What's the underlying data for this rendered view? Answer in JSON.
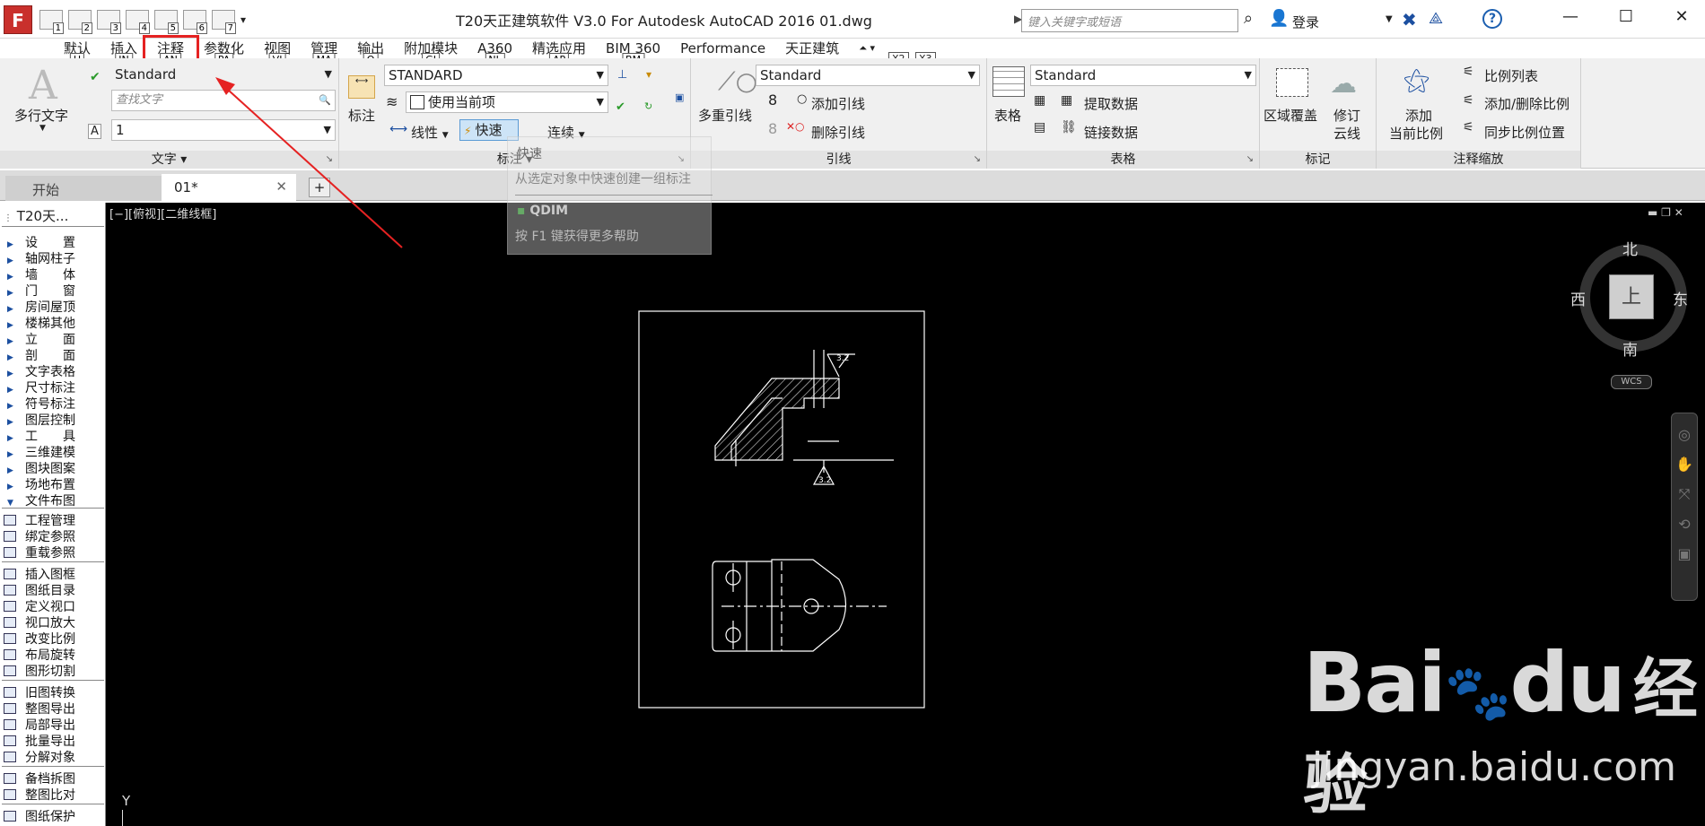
{
  "title_bar": {
    "app_icon": "F",
    "qat_keys": [
      "1",
      "2",
      "3",
      "4",
      "5",
      "6",
      "7"
    ],
    "title": "T20天正建筑软件 V3.0 For Autodesk AutoCAD 2016     01.dwg",
    "search_placeholder": "键入关键字或短语",
    "login": "登录",
    "help": "?"
  },
  "menu_tabs": [
    {
      "label": "默认",
      "key": "H"
    },
    {
      "label": "插入",
      "key": "IN"
    },
    {
      "label": "注释",
      "key": "AN"
    },
    {
      "label": "参数化",
      "key": "PA"
    },
    {
      "label": "视图",
      "key": "VI"
    },
    {
      "label": "管理",
      "key": "MA"
    },
    {
      "label": "输出",
      "key": "O"
    },
    {
      "label": "附加模块",
      "key": "GI"
    },
    {
      "label": "A360",
      "key": "NL"
    },
    {
      "label": "精选应用",
      "key": "AP"
    },
    {
      "label": "BIM 360",
      "key": "BM"
    },
    {
      "label": "Performance",
      "key": ""
    },
    {
      "label": "天正建筑",
      "key": ""
    }
  ],
  "ribbon_extra_keys": [
    "X2",
    "X3"
  ],
  "ribbon": {
    "text_panel": {
      "title": "文字",
      "big_button": "多行文字",
      "style": "Standard",
      "find_placeholder": "查找文字",
      "height": "1"
    },
    "dim_panel": {
      "title": "标注",
      "big_button": "标注",
      "style": "STANDARD",
      "layer": "使用当前项",
      "linear": "线性",
      "quick": "快速",
      "continue": "连续"
    },
    "leader_panel": {
      "title": "引线",
      "big_button": "多重引线",
      "style": "Standard",
      "add": "添加引线",
      "remove": "删除引线"
    },
    "table_panel": {
      "title": "表格",
      "big_button": "表格",
      "style": "Standard",
      "extract": "提取数据",
      "link": "链接数据"
    },
    "markup_panel": {
      "title": "标记",
      "wipeout": "区域覆盖",
      "revcloud_1": "修订",
      "revcloud_2": "云线"
    },
    "scale_panel": {
      "title": "注释缩放",
      "add_1": "添加",
      "add_2": "当前比例",
      "scale_list": "比例列表",
      "add_remove": "添加/删除比例",
      "sync": "同步比例位置"
    }
  },
  "tooltip": {
    "title": "快速",
    "desc": "从选定对象中快速创建一组标注",
    "command": "QDIM",
    "help": "按 F1 键获得更多帮助"
  },
  "doc_tabs": {
    "start": "开始",
    "current": "01*",
    "add": "+"
  },
  "left_panel": {
    "title": "T20天...",
    "menu_items": [
      "设　　置",
      "轴网柱子",
      "墙　　体",
      "门　　窗",
      "房间屋顶",
      "楼梯其他",
      "立　　面",
      "剖　　面",
      "文字表格",
      "尺寸标注",
      "符号标注",
      "图层控制",
      "工　　具",
      "三维建模",
      "图块图案",
      "场地布置",
      "文件布图"
    ],
    "group1": [
      "工程管理",
      "绑定参照",
      "重载参照"
    ],
    "group2": [
      "插入图框",
      "图纸目录",
      "定义视口",
      "视口放大",
      "改变比例",
      "布局旋转",
      "图形切割"
    ],
    "group3": [
      "旧图转换",
      "整图导出",
      "局部导出",
      "批量导出",
      "分解对象"
    ],
    "group4": [
      "备档拆图",
      "整图比对"
    ],
    "group5": [
      "图纸保护"
    ]
  },
  "canvas": {
    "view_label": "[−][俯视][二维线框]",
    "compass": {
      "north": "北",
      "south": "南",
      "east": "东",
      "west": "西",
      "top": "上"
    },
    "wcs": "WCS",
    "roughness": "3.2",
    "axis": "Y"
  },
  "watermark": {
    "brand": "Bai",
    "brand2": "du",
    "cn": "经验",
    "url": "jingyan.baidu.com"
  }
}
